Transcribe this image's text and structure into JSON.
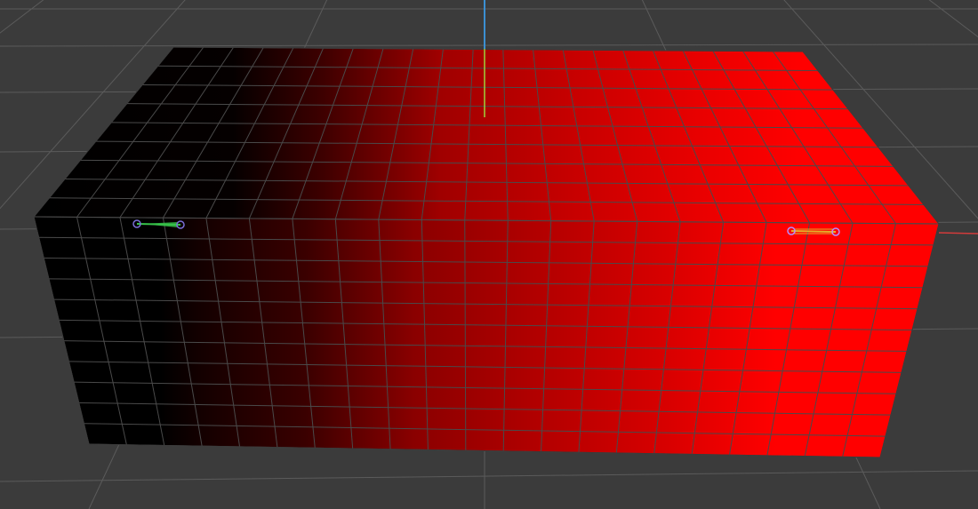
{
  "viewport": {
    "background": "#3b3b3b",
    "floor_grid_color": "#5b5b5b",
    "mesh_wire_color": "#4a4a4a"
  },
  "axes": {
    "x_axis_color": "#d23b3b",
    "y_axis_color": "#3b8fd2",
    "z_axis_color": "#9fd23b"
  },
  "mesh": {
    "name": "box-mesh",
    "gradient": [
      "#000000",
      "#190000",
      "#8a0000",
      "#ff0000"
    ],
    "top_gradient": [
      "#000000",
      "#300000",
      "#a00000",
      "#ff0000"
    ]
  },
  "gizmos": [
    {
      "name": "green-handle-icon",
      "color": "#37c24a"
    },
    {
      "name": "yellow-handle-icon",
      "color": "#e3b02a"
    }
  ]
}
